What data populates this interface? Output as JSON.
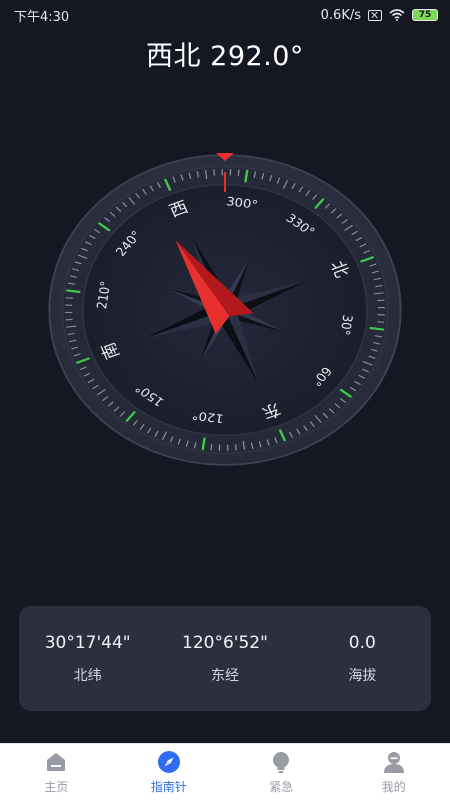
{
  "status_bar": {
    "time": "下午4:30",
    "network_speed": "0.6K/s",
    "battery": "75",
    "icons": [
      "sim-disabled-icon",
      "wifi-icon",
      "battery-icon"
    ]
  },
  "heading": {
    "direction": "西北",
    "degrees": "292.0°"
  },
  "compass": {
    "heading_deg": 292.0,
    "cardinals": [
      {
        "label": "北",
        "angle": 0
      },
      {
        "label": "东",
        "angle": 90
      },
      {
        "label": "南",
        "angle": 180
      },
      {
        "label": "西",
        "angle": 270
      }
    ],
    "degree_labels": [
      {
        "label": "30°",
        "angle": 30
      },
      {
        "label": "60°",
        "angle": 60
      },
      {
        "label": "120°",
        "angle": 120
      },
      {
        "label": "150°",
        "angle": 150
      },
      {
        "label": "210°",
        "angle": 210
      },
      {
        "label": "240°",
        "angle": 240
      },
      {
        "label": "300°",
        "angle": 300
      },
      {
        "label": "330°",
        "angle": 330
      }
    ],
    "colors": {
      "needle": "#e8302f",
      "needle_dark": "#b3191c",
      "marker": "#e8302f",
      "green_tick": "#3ecb4d",
      "tick": "#8c92a4",
      "ring_outer": "#2c3040",
      "ring_inner": "#232634",
      "face": "#1c1f2c"
    }
  },
  "location": {
    "latitude": "30°17'44\"",
    "latitude_label": "北纬",
    "longitude": "120°6'52\"",
    "longitude_label": "东经",
    "altitude": "0.0",
    "altitude_label": "海拔"
  },
  "tabs": [
    {
      "label": "主页",
      "icon": "home-icon",
      "active": false
    },
    {
      "label": "指南针",
      "icon": "compass-icon",
      "active": true
    },
    {
      "label": "紧急",
      "icon": "lightbulb-icon",
      "active": false
    },
    {
      "label": "我的",
      "icon": "profile-icon",
      "active": false
    }
  ],
  "accent_color": "#2f6cf0"
}
